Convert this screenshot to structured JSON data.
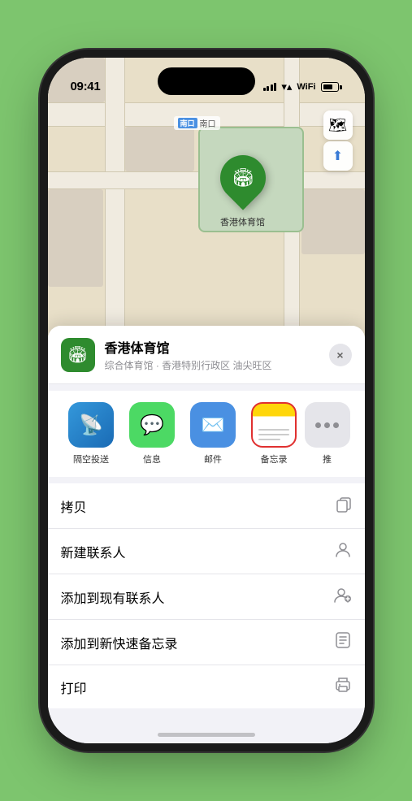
{
  "status_bar": {
    "time": "09:41",
    "location_icon": "◀",
    "signal_label": "signal",
    "wifi_label": "wifi",
    "battery_label": "battery"
  },
  "map": {
    "road_label": "南口",
    "road_badge": "南口",
    "pin_label": "香港体育馆",
    "pin_icon": "🏟"
  },
  "map_controls": {
    "map_icon": "🗺",
    "location_icon": "⬆"
  },
  "venue_sheet": {
    "venue_icon": "🏟",
    "venue_name": "香港体育馆",
    "venue_sub": "综合体育馆 · 香港特别行政区 油尖旺区",
    "close_label": "×"
  },
  "share_items": [
    {
      "id": "airdrop",
      "label": "隔空投送",
      "type": "airdrop"
    },
    {
      "id": "messages",
      "label": "信息",
      "type": "messages"
    },
    {
      "id": "mail",
      "label": "邮件",
      "type": "mail"
    },
    {
      "id": "notes",
      "label": "备忘录",
      "type": "notes"
    },
    {
      "id": "more",
      "label": "推",
      "type": "more"
    }
  ],
  "action_items": [
    {
      "id": "copy",
      "label": "拷贝",
      "icon": "copy"
    },
    {
      "id": "add-contact",
      "label": "新建联系人",
      "icon": "person"
    },
    {
      "id": "add-existing",
      "label": "添加到现有联系人",
      "icon": "person-add"
    },
    {
      "id": "quick-note",
      "label": "添加到新快速备忘录",
      "icon": "note"
    },
    {
      "id": "print",
      "label": "打印",
      "icon": "print"
    }
  ],
  "colors": {
    "green": "#2e8b2e",
    "notes_selected_border": "#e03030",
    "background": "#7dc56e"
  }
}
